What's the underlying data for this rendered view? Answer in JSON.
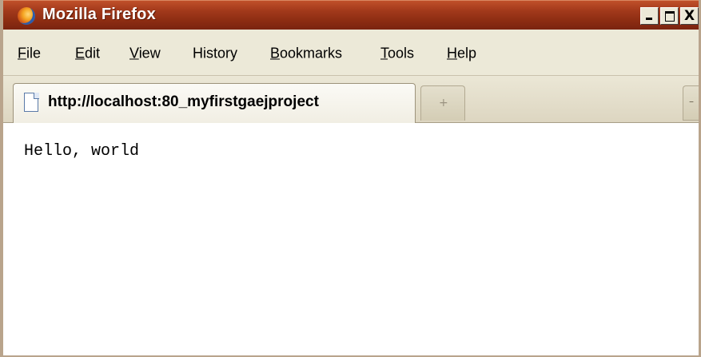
{
  "window": {
    "title": "Mozilla Firefox",
    "close_glyph": "X"
  },
  "menu": {
    "items": [
      "File",
      "Edit",
      "View",
      "History",
      "Bookmarks",
      "Tools",
      "Help"
    ]
  },
  "tabs": {
    "active_label": "http://localhost:80_myfirstgaejproject",
    "new_tab_glyph": "+"
  },
  "page": {
    "body_text": "Hello, world"
  },
  "colors": {
    "titlebar": "#a2391b",
    "chrome": "#ece9d8",
    "content": "#ffffff"
  }
}
